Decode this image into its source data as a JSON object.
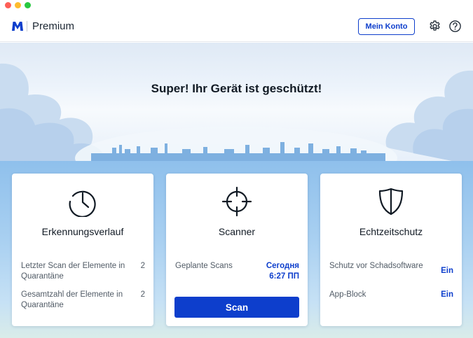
{
  "app": {
    "product_name": "Premium",
    "account_button": "Mein Konto"
  },
  "icons": {
    "logo": "malwarebytes-logo",
    "settings": "gear-icon",
    "help": "help-icon",
    "history": "clock-history-icon",
    "scanner": "crosshair-icon",
    "realtime": "shield-icon"
  },
  "hero": {
    "title": "Super! Ihr Gerät ist geschützt!"
  },
  "cards": {
    "history": {
      "title": "Erkennungsverlauf",
      "rows": [
        {
          "label": "Letzter Scan der Elemente in Quarantäne",
          "value": "2"
        },
        {
          "label": "Gesamtzahl der Elemente in Quarantäne",
          "value": "2"
        }
      ]
    },
    "scanner": {
      "title": "Scanner",
      "scheduled_label": "Geplante Scans",
      "scheduled_day": "Сегодня",
      "scheduled_time": "6:27 ПП",
      "scan_button": "Scan"
    },
    "realtime": {
      "title": "Echtzeitschutz",
      "rows": [
        {
          "label": "Schutz vor Schadsoftware",
          "value": "Ein"
        },
        {
          "label": "App-Block",
          "value": "Ein"
        }
      ]
    }
  },
  "colors": {
    "accent": "#0d3ecc",
    "text_dark": "#111a24",
    "text_muted": "#515b66"
  }
}
